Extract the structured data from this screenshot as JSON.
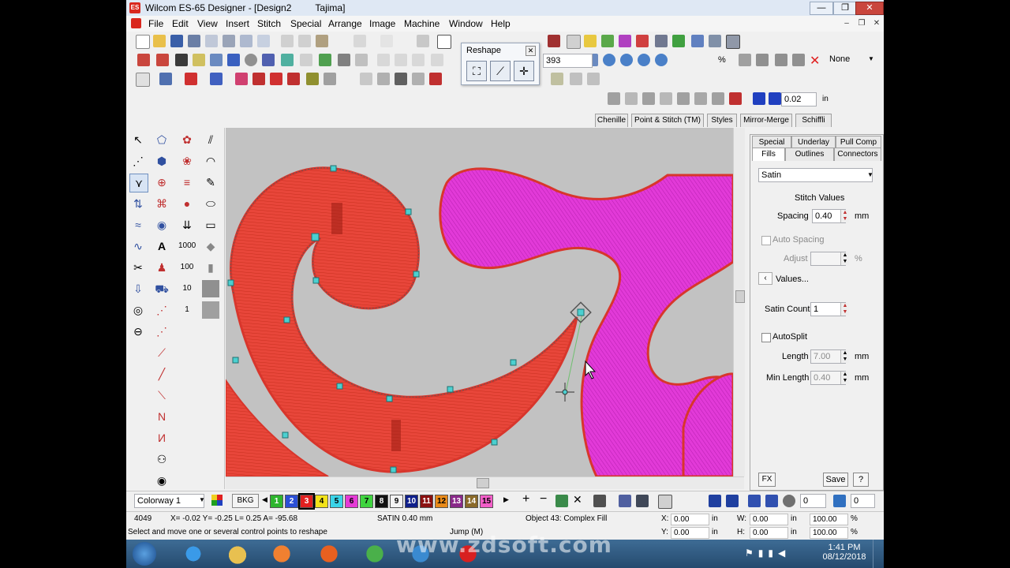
{
  "window": {
    "app_logo": "ES",
    "title": "Wilcom ES-65 Designer - [Design2",
    "machine": "Tajima]",
    "controls": {
      "minimize": "—",
      "maximize": "❐",
      "close": "✕"
    }
  },
  "menu": {
    "items": [
      "File",
      "Edit",
      "View",
      "Insert",
      "Stitch",
      "Special",
      "Arrange",
      "Image",
      "Machine",
      "Window",
      "Help"
    ],
    "mdi": {
      "minimize": "–",
      "restore": "❐",
      "close": "✕"
    }
  },
  "toolbar": {
    "zoom_value": "393",
    "zoom_unit": "%",
    "none_label": "None",
    "grid_value": "0.02",
    "grid_unit": "in"
  },
  "reshape_toolbar": {
    "title": "Reshape",
    "close": "✕"
  },
  "tabs_top": [
    "Chenille",
    "Point & Stitch (TM)",
    "Styles",
    "Mirror-Merge",
    "Schiffli"
  ],
  "object_props": {
    "tabs_row1": [
      "Special",
      "Underlay",
      "Pull Comp"
    ],
    "tabs_row2": [
      "Fills",
      "Outlines",
      "Connectors"
    ],
    "fill_type": "Satin",
    "section_title": "Stitch Values",
    "spacing_label": "Spacing",
    "spacing_value": "0.40",
    "unit_mm": "mm",
    "auto_spacing_label": "Auto Spacing",
    "adjust_label": "Adjust",
    "adjust_unit": "%",
    "values_label": "Values...",
    "satin_count_label": "Satin Count",
    "satin_count_value": "1",
    "autosplit_label": "AutoSplit",
    "length_label": "Length",
    "length_value": "7.00",
    "min_length_label": "Min Length",
    "min_length_value": "0.40",
    "fx_label": "FX",
    "save_label": "Save",
    "help_label": "?"
  },
  "colorway": {
    "name": "Colorway 1",
    "bkg_label": "BKG",
    "swatches": [
      {
        "n": "1",
        "c": "#2db52d"
      },
      {
        "n": "2",
        "c": "#2b4fd6"
      },
      {
        "n": "3",
        "c": "#e02020"
      },
      {
        "n": "4",
        "c": "#f2e21a"
      },
      {
        "n": "5",
        "c": "#3ad4e8"
      },
      {
        "n": "6",
        "c": "#e53ad6"
      },
      {
        "n": "7",
        "c": "#3fd43f"
      },
      {
        "n": "8",
        "c": "#111111"
      },
      {
        "n": "9",
        "c": "#f4f4f4"
      },
      {
        "n": "10",
        "c": "#0f1f8a"
      },
      {
        "n": "11",
        "c": "#8a1010"
      },
      {
        "n": "12",
        "c": "#e88a1a"
      },
      {
        "n": "13",
        "c": "#8a2a8a"
      },
      {
        "n": "14",
        "c": "#8a6a2a"
      },
      {
        "n": "15",
        "c": "#f25ec8"
      }
    ],
    "step_value": "0",
    "step_value2": "0"
  },
  "status": {
    "stitch_count": "4049",
    "coords": "X= -0.02 Y= -0.25 L=  0.25 A= -95.68",
    "stitch_type": "SATIN  0.40 mm",
    "object": "Object 43: Complex Fill",
    "x_label": "X:",
    "x_value": "0.00",
    "y_label": "Y:",
    "y_value": "0.00",
    "w_label": "W:",
    "w_value": "0.00",
    "h_label": "H:",
    "h_value": "0.00",
    "unit_in": "in",
    "pct_w": "100.00",
    "pct_h": "100.00",
    "pct_sym": "%",
    "hint": "Select and move one or several control points to reshape",
    "mode": "Jump (M)"
  },
  "taskbar": {
    "time": "1:41 PM",
    "date": "08/12/2018",
    "watermark": "www.zdsoft.com"
  }
}
